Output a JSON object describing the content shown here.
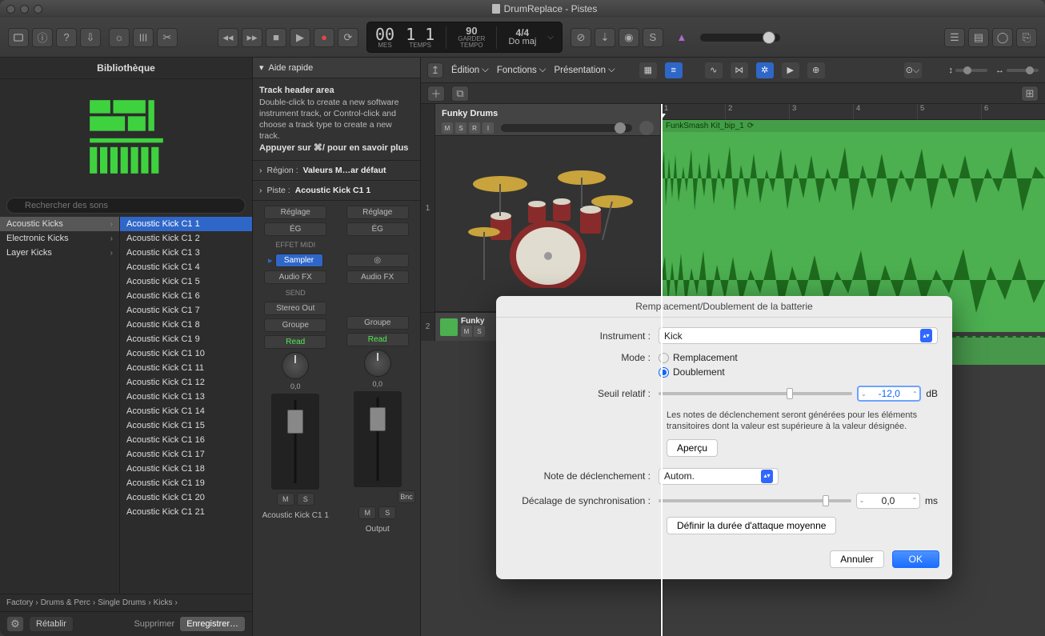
{
  "window": {
    "title": "DrumReplace - Pistes"
  },
  "transport": {
    "bars": "00",
    "beats": "1 1",
    "tempo_value": "90",
    "tempo_caption": "TEMPO",
    "keep": "GARDER",
    "sig": "4/4",
    "key": "Do maj",
    "mes": "MES",
    "temps": "TEMPS"
  },
  "library": {
    "title": "Bibliothèque",
    "search_placeholder": "Rechercher des sons",
    "categories": [
      {
        "label": "Acoustic Kicks",
        "sel": true
      },
      {
        "label": "Electronic Kicks"
      },
      {
        "label": "Layer Kicks"
      }
    ],
    "items": [
      "Acoustic Kick C1 1",
      "Acoustic Kick C1 2",
      "Acoustic Kick C1 3",
      "Acoustic Kick C1 4",
      "Acoustic Kick C1 5",
      "Acoustic Kick C1 6",
      "Acoustic Kick C1 7",
      "Acoustic Kick C1 8",
      "Acoustic Kick C1 9",
      "Acoustic Kick C1 10",
      "Acoustic Kick C1 11",
      "Acoustic Kick C1 12",
      "Acoustic Kick C1 13",
      "Acoustic Kick C1 14",
      "Acoustic Kick C1 15",
      "Acoustic Kick C1 16",
      "Acoustic Kick C1 17",
      "Acoustic Kick C1 18",
      "Acoustic Kick C1 19",
      "Acoustic Kick C1 20",
      "Acoustic Kick C1 21"
    ],
    "path": [
      "Factory",
      "Drums & Perc",
      "Single Drums",
      "Kicks"
    ],
    "restore": "Rétablir",
    "delete": "Supprimer",
    "save": "Enregistrer…"
  },
  "help": {
    "title": "Aide rapide",
    "heading": "Track header area",
    "body": "Double-click to create a new software instrument track, or Control-click and choose a track type to create a new track.",
    "more": "Appuyer sur ⌘/ pour en savoir plus",
    "region_label": "Région :",
    "region_value": "Valeurs M…ar défaut",
    "track_label": "Piste :",
    "track_value": "Acoustic Kick C1 1"
  },
  "channel": {
    "setting": "Réglage",
    "eq": "ÉG",
    "midi_fx": "EFFET MIDI",
    "sampler": "Sampler",
    "audio_fx": "Audio FX",
    "send": "Send",
    "stereo_out": "Stereo Out",
    "group": "Groupe",
    "read": "Read",
    "pan": "0,0",
    "name1": "Acoustic Kick C1 1",
    "name2": "Output",
    "bnc": "Bnc",
    "m": "M",
    "s": "S"
  },
  "menus": {
    "edition": "Édition",
    "functions": "Fonctions",
    "presentation": "Présentation"
  },
  "ruler": [
    "1",
    "2",
    "3",
    "4",
    "5",
    "6"
  ],
  "track1": {
    "num": "1",
    "name": "Funky Drums",
    "m": "M",
    "s": "S",
    "r": "R",
    "i": "I"
  },
  "track2": {
    "num": "2",
    "name": "Funky",
    "m": "M",
    "s": "S"
  },
  "region": {
    "name": "FunkSmash Kit_bip_1"
  },
  "dialog": {
    "title": "Remplacement/Doublement de la batterie",
    "instrument_label": "Instrument :",
    "instrument_value": "Kick",
    "mode_label": "Mode :",
    "mode_replace": "Remplacement",
    "mode_double": "Doublement",
    "threshold_label": "Seuil relatif :",
    "threshold_value": "-12,0",
    "threshold_unit": "dB",
    "hint": "Les notes de déclenchement seront générées pour les éléments transitoires dont la valeur est supérieure à la valeur désignée.",
    "preview": "Aperçu",
    "trigger_label": "Note de déclenchement :",
    "trigger_value": "Autom.",
    "offset_label": "Décalage de synchronisation :",
    "offset_value": "0,0",
    "offset_unit": "ms",
    "avg_attack": "Définir la durée d'attaque moyenne",
    "cancel": "Annuler",
    "ok": "OK"
  }
}
